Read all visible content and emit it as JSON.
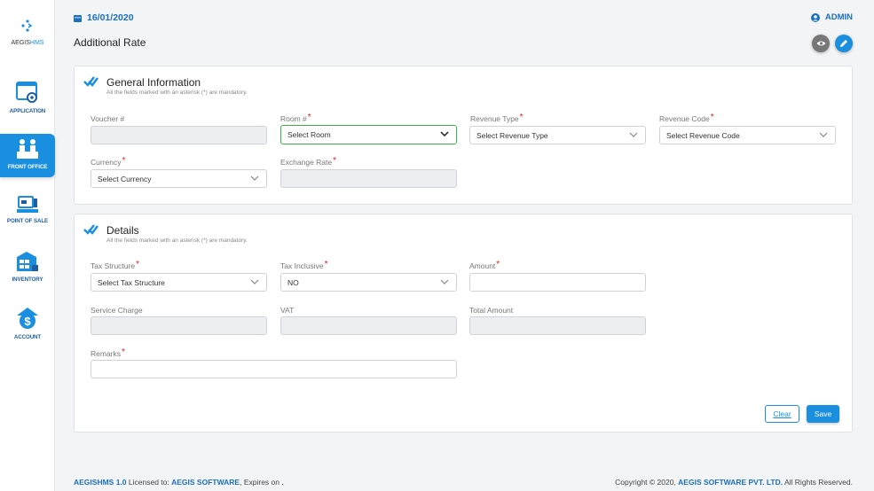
{
  "brand": {
    "name_prefix": "AEGIS",
    "name_suffix": "HMS"
  },
  "sidebar": {
    "items": [
      {
        "label": "APPLICATION",
        "icon": "application-gear-icon"
      },
      {
        "label": "FRONT OFFICE",
        "icon": "front-office-icon",
        "active": true
      },
      {
        "label": "POINT OF SALE",
        "icon": "point-of-sale-icon"
      },
      {
        "label": "INVENTORY",
        "icon": "inventory-icon"
      },
      {
        "label": "ACCOUNT",
        "icon": "account-dollar-icon"
      }
    ]
  },
  "header": {
    "date": "16/01/2020",
    "user": "ADMIN",
    "page_title": "Additional Rate"
  },
  "general": {
    "title": "General Information",
    "subtitle": "All the fields marked with an asterisk (*) are mandatory.",
    "voucher_label": "Voucher #",
    "room_label": "Room #",
    "room_value": "Select Room",
    "revenue_type_label": "Revenue Type",
    "revenue_type_value": "Select Revenue Type",
    "revenue_code_label": "Revenue Code",
    "revenue_code_value": "Select Revenue Code",
    "currency_label": "Currency",
    "currency_value": "Select Currency",
    "exchange_rate_label": "Exchange Rate"
  },
  "details": {
    "title": "Details",
    "subtitle": "All the fields marked with an asterisk (*) are mandatory.",
    "tax_structure_label": "Tax Structure",
    "tax_structure_value": "Select Tax Structure",
    "tax_inclusive_label": "Tax Inclusive",
    "tax_inclusive_value": "NO",
    "amount_label": "Amount",
    "service_charge_label": "Service Charge",
    "vat_label": "VAT",
    "total_amount_label": "Total Amount",
    "remarks_label": "Remarks"
  },
  "actions": {
    "clear": "Clear",
    "save": "Save"
  },
  "footer": {
    "product": "AEGISHMS 1.0",
    "licensed_text": "Licensed to:",
    "licensee": "AEGIS SOFTWARE",
    "expires_text": ", Expires on .",
    "copyright_text": "Copyright © 2020,",
    "company": "AEGIS SOFTWARE PVT. LTD.",
    "rights_text": "All Rights Reserved."
  },
  "colors": {
    "accent": "#1a8fe0",
    "nav_text": "#1f5fa0",
    "required": "#e02020",
    "focus": "#3fae4b"
  }
}
